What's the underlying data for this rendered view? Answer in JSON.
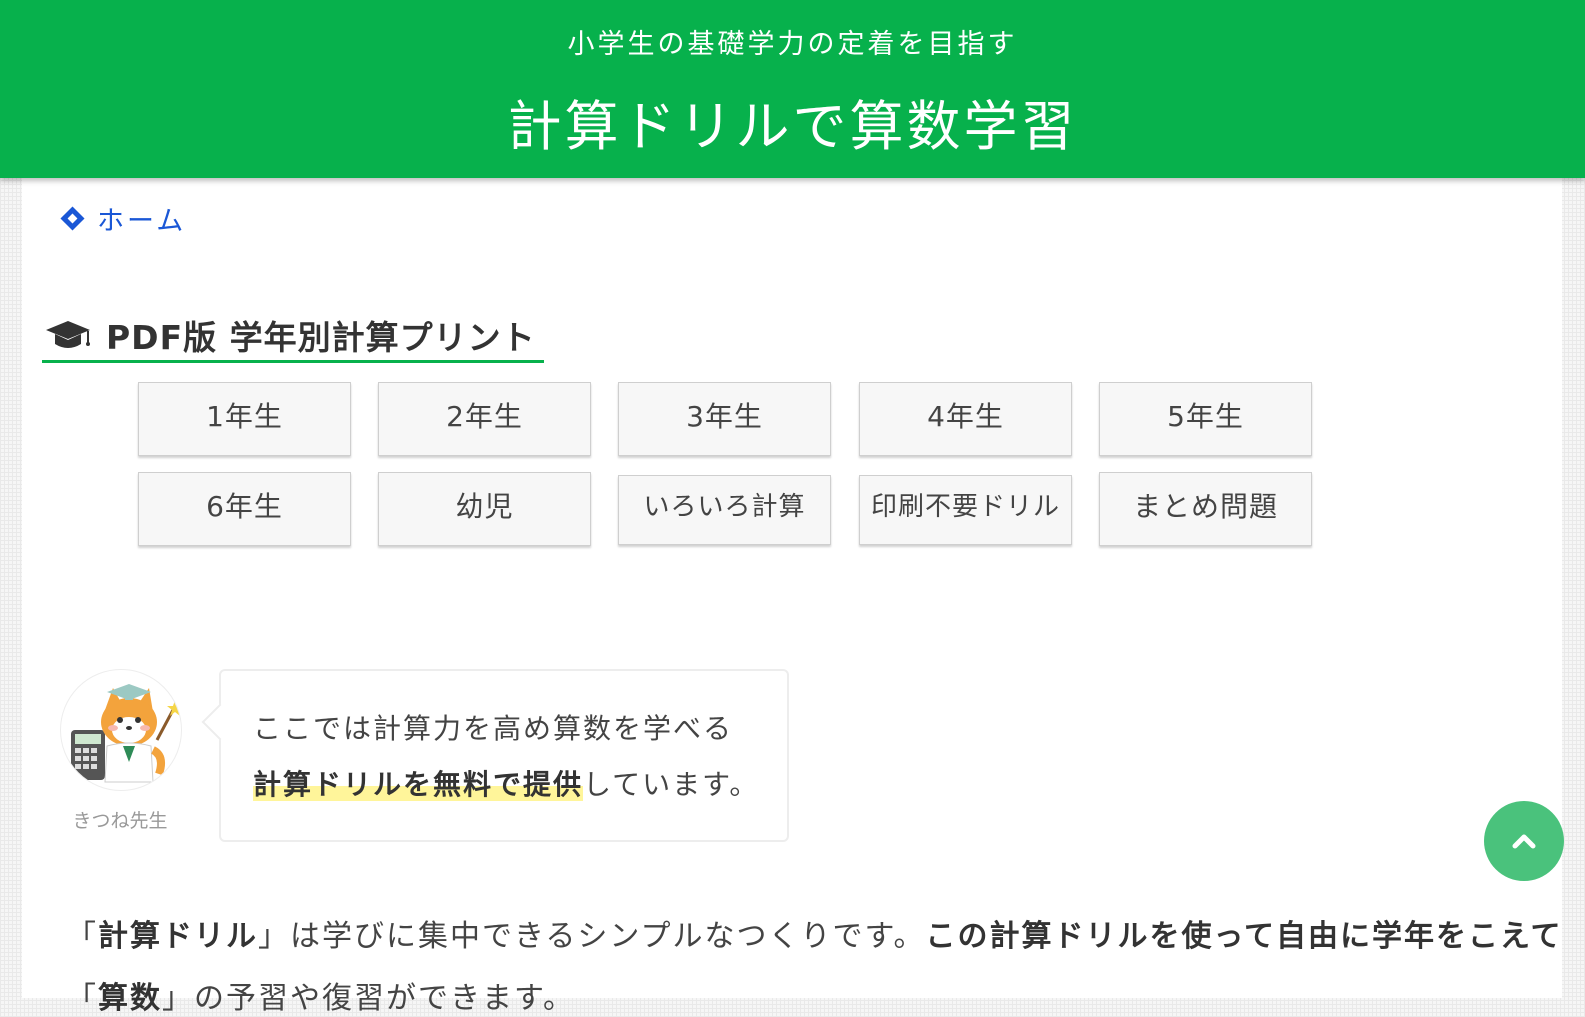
{
  "header": {
    "tagline": "小学生の基礎学力の定着を目指す",
    "site_title": "計算ドリルで算数学習"
  },
  "breadcrumb": {
    "home_label": "ホーム"
  },
  "section": {
    "heading": "PDF版 学年別計算プリント",
    "icon": "graduation-cap-icon"
  },
  "grades": [
    {
      "label": "1年生"
    },
    {
      "label": "2年生"
    },
    {
      "label": "3年生"
    },
    {
      "label": "4年生"
    },
    {
      "label": "5年生"
    },
    {
      "label": "6年生"
    },
    {
      "label": "幼児"
    },
    {
      "label": "いろいろ計算"
    },
    {
      "label": "印刷不要ドリル"
    },
    {
      "label": "まとめ問題"
    }
  ],
  "speech": {
    "speaker_name": "きつね先生",
    "line1": "ここでは計算力を高め算数を学べる",
    "line2_highlight": "計算ドリルを無料で提供",
    "line2_rest": "しています。"
  },
  "intro": {
    "open_quote": "「",
    "term": "計算ドリル",
    "close_quote": "」",
    "middle": "は学びに集中できるシンプルなつくりです。",
    "bold_tail": "この計算ドリルを使って自由に学年をこえて",
    "line2_open": "「",
    "line2_term": "算数",
    "line2_rest": "」の予習や復習ができます。"
  },
  "colors": {
    "header_green": "#07b14c",
    "link_blue": "#1a57d6",
    "scroll_button": "#4ac27c",
    "marker_yellow": "#fff59a"
  },
  "scroll_top": {
    "icon": "chevron-up-icon"
  }
}
